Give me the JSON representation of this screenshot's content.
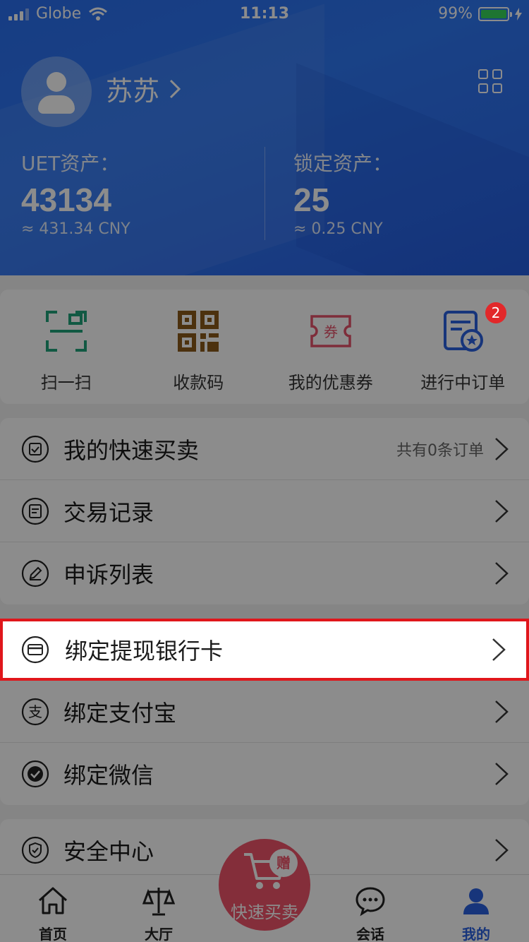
{
  "status_bar": {
    "carrier": "Globe",
    "time": "11:13",
    "battery": "99%",
    "battery_level": 0.99
  },
  "profile": {
    "username": "苏苏"
  },
  "assets": {
    "uet_label": "UET资产：",
    "uet_value": "43134",
    "uet_cny": "≈ 431.34 CNY",
    "locked_label": "锁定资产：",
    "locked_value": "25",
    "locked_cny": "≈ 0.25 CNY"
  },
  "quick_actions": [
    {
      "label": "扫一扫",
      "icon": "scan-icon",
      "color": "#1fa37a"
    },
    {
      "label": "收款码",
      "icon": "qr-code-icon",
      "color": "#8a5a1a"
    },
    {
      "label": "我的优惠券",
      "icon": "coupon-icon",
      "color": "#e5536b"
    },
    {
      "label": "进行中订单",
      "icon": "order-icon",
      "color": "#2b62e0",
      "badge": "2"
    }
  ],
  "list_group1": [
    {
      "label": "我的快速买卖",
      "extra": "共有0条订单",
      "icon": "calendar-check-icon"
    },
    {
      "label": "交易记录",
      "icon": "record-icon"
    },
    {
      "label": "申诉列表",
      "icon": "edit-icon"
    }
  ],
  "list_group2": [
    {
      "label": "绑定提现银行卡",
      "icon": "bank-card-icon"
    },
    {
      "label": "绑定支付宝",
      "icon": "alipay-icon"
    },
    {
      "label": "绑定微信",
      "icon": "wechat-icon"
    }
  ],
  "list_group3": [
    {
      "label": "安全中心",
      "icon": "shield-icon"
    }
  ],
  "tabbar": {
    "items": [
      {
        "label": "首页",
        "icon": "home-icon"
      },
      {
        "label": "大厅",
        "icon": "scale-icon"
      },
      {
        "label": "",
        "icon": ""
      },
      {
        "label": "会话",
        "icon": "chat-icon"
      },
      {
        "label": "我的",
        "icon": "user-icon"
      }
    ],
    "fab_label": "快速买卖",
    "fab_badge": "赠"
  },
  "colors": {
    "accent": "#2b62e0",
    "header": "#2f78f4",
    "fab": "#f0546a",
    "highlight": "#e0161b"
  }
}
